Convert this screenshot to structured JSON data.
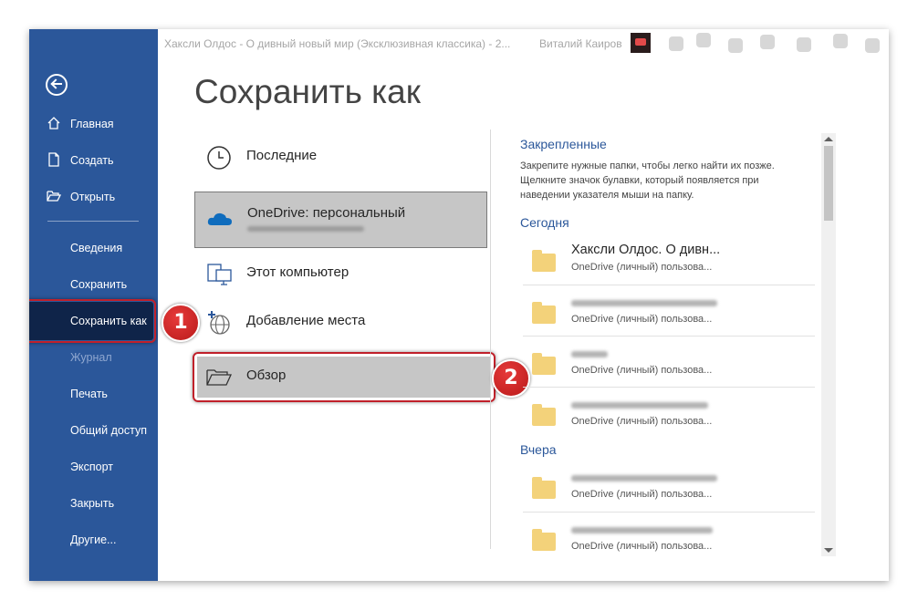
{
  "window": {
    "title": "Хаксли Олдос - О дивный новый мир (Эксклюзивная классика) - 2...",
    "user_name": "Виталий Каиров"
  },
  "sidebar": {
    "items": [
      {
        "label": "Главная",
        "icon": "home-icon"
      },
      {
        "label": "Создать",
        "icon": "new-document-icon"
      },
      {
        "label": "Открыть",
        "icon": "open-folder-icon"
      },
      {
        "label": "Сведения"
      },
      {
        "label": "Сохранить"
      },
      {
        "label": "Сохранить как"
      },
      {
        "label": "Журнал"
      },
      {
        "label": "Печать"
      },
      {
        "label": "Общий доступ"
      },
      {
        "label": "Экспорт"
      },
      {
        "label": "Закрыть"
      },
      {
        "label": "Другие..."
      }
    ]
  },
  "page": {
    "title": "Сохранить как"
  },
  "locations": {
    "recent": "Последние",
    "onedrive": "OneDrive: персональный",
    "this_pc": "Этот компьютер",
    "add_place": "Добавление места",
    "browse": "Обзор"
  },
  "badges": {
    "one": "1",
    "two": "2"
  },
  "pinned": {
    "title": "Закрепленные",
    "description": "Закрепите нужные папки, чтобы легко найти их позже. Щелкните значок булавки, который появляется при наведении указателя мыши на папку."
  },
  "sections": {
    "today": "Сегодня",
    "yesterday": "Вчера"
  },
  "files": [
    {
      "name": "Хаксли Олдос. О дивн...",
      "location": "OneDrive (личный) пользова..."
    },
    {
      "name": "",
      "location": "OneDrive (личный) пользова..."
    },
    {
      "name": "",
      "location": "OneDrive (личный) пользова..."
    },
    {
      "name": "",
      "location": "OneDrive (личный) пользова..."
    },
    {
      "name": "",
      "location": "OneDrive (личный) пользова..."
    },
    {
      "name": "",
      "location": "OneDrive (личный) пользова..."
    }
  ],
  "colors": {
    "sidebar": "#2b579a",
    "accent": "#2b579a",
    "highlight_border": "#c0202a",
    "badge": "#d42a2a"
  }
}
